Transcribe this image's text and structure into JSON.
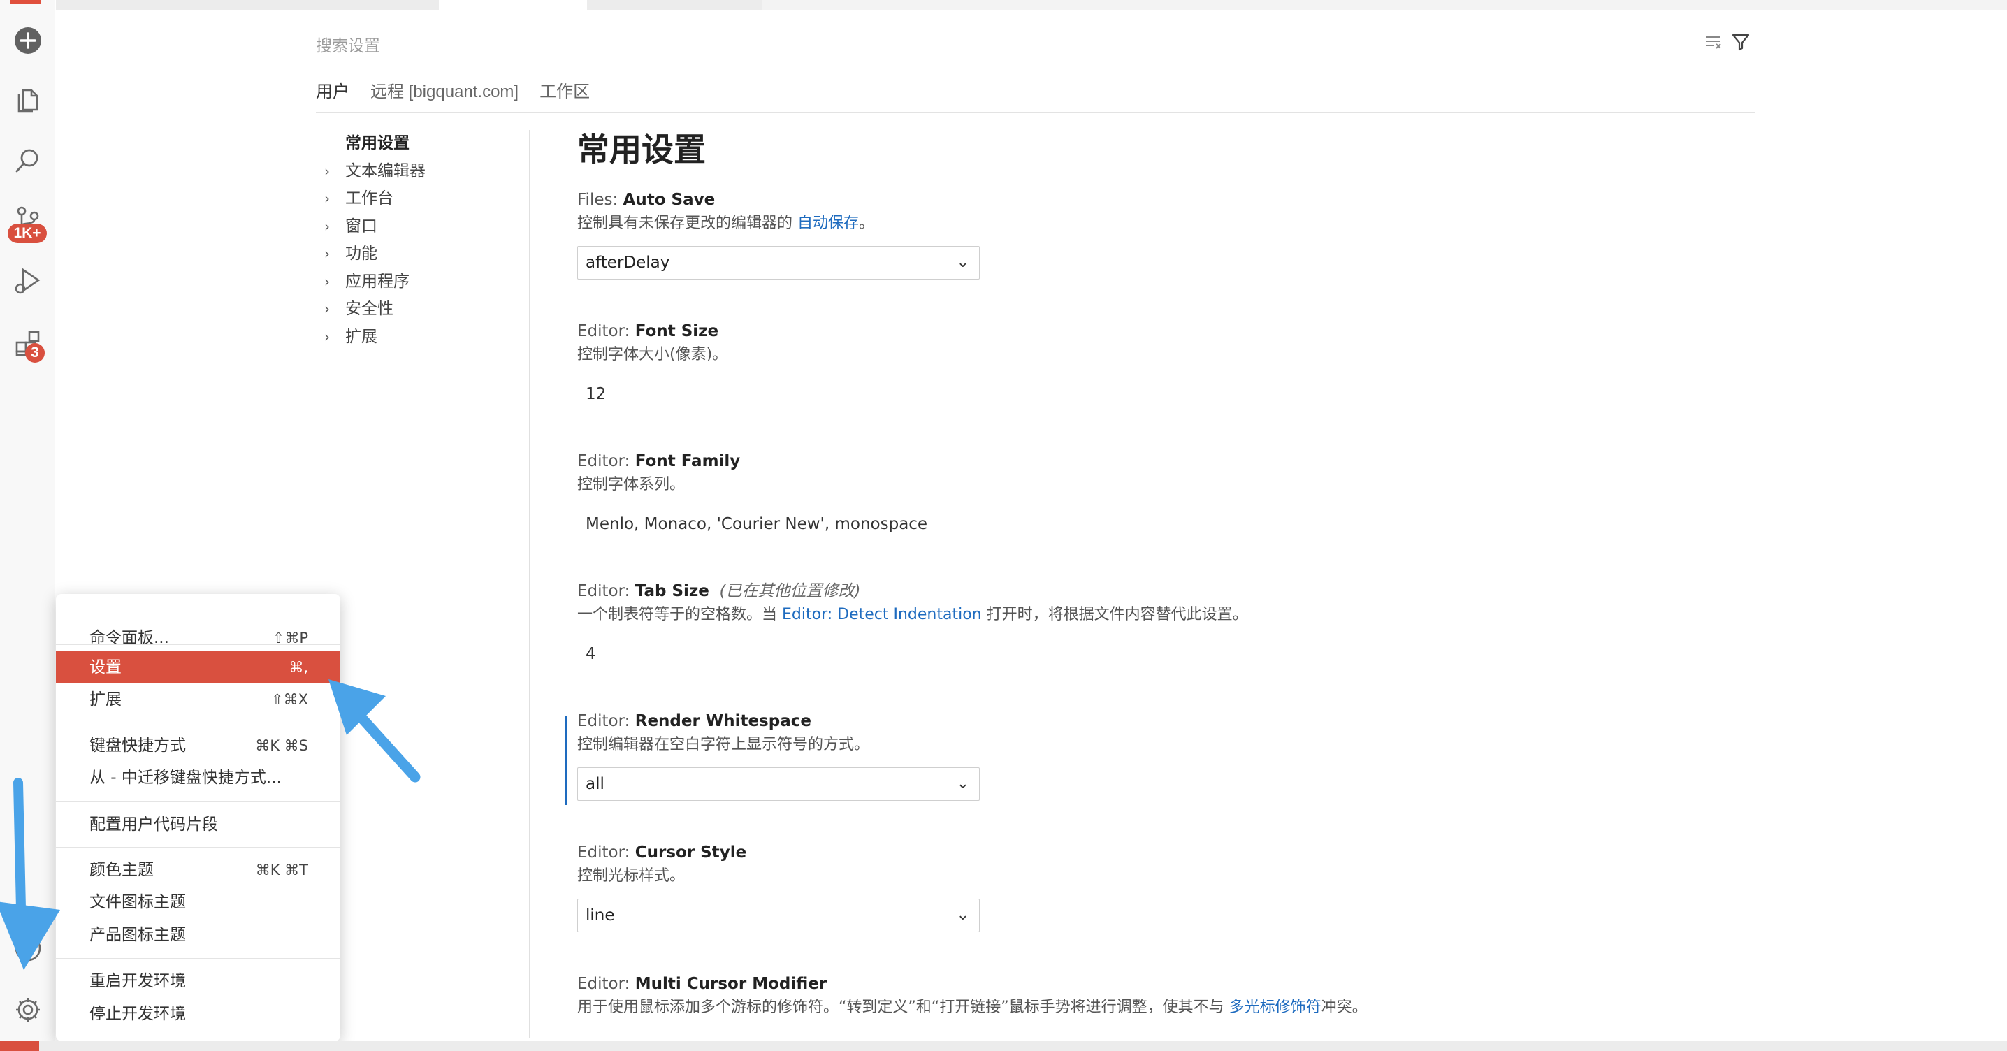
{
  "activity_bar": {
    "icons": [
      "add-icon",
      "explorer-icon",
      "search-icon",
      "source-control-icon",
      "run-debug-icon",
      "extensions-icon",
      "accounts-icon",
      "manage-gear-icon"
    ],
    "source_control_badge": "1K+",
    "extensions_badge": "3"
  },
  "settings": {
    "search_placeholder": "搜索设置",
    "scope_tabs": [
      "用户",
      "远程 [bigquant.com]",
      "工作区"
    ],
    "toc": {
      "root": "常用设置",
      "items": [
        "文本编辑器",
        "工作台",
        "窗口",
        "功能",
        "应用程序",
        "安全性",
        "扩展"
      ]
    },
    "section_title": "常用设置",
    "items": [
      {
        "category": "Files: ",
        "name": "Auto Save",
        "desc_pre": "控制具有未保存更改的编辑器的 ",
        "desc_link": "自动保存",
        "desc_post": "。",
        "value": "afterDelay"
      },
      {
        "category": "Editor: ",
        "name": "Font Size",
        "desc": "控制字体大小(像素)。",
        "value": "12"
      },
      {
        "category": "Editor: ",
        "name": "Font Family",
        "desc": "控制字体系列。",
        "value": "Menlo, Monaco, 'Courier New', monospace"
      },
      {
        "category": "Editor: ",
        "name": "Tab Size",
        "note": "(已在其他位置修改)",
        "desc_pre": "一个制表符等于的空格数。当 ",
        "desc_link": "Editor: Detect Indentation",
        "desc_post": " 打开时，将根据文件内容替代此设置。",
        "value": "4"
      },
      {
        "category": "Editor: ",
        "name": "Render Whitespace",
        "desc": "控制编辑器在空白字符上显示符号的方式。",
        "value": "all"
      },
      {
        "category": "Editor: ",
        "name": "Cursor Style",
        "desc": "控制光标样式。",
        "value": "line"
      },
      {
        "category": "Editor: ",
        "name": "Multi Cursor Modifier",
        "desc_pre": "用于使用鼠标添加多个游标的修饰符。“转到定义”和“打开链接”鼠标手势将进行调整，使其不与 ",
        "desc_link": "多光标修饰符",
        "desc_post": "冲突。"
      }
    ]
  },
  "manage_menu": {
    "items": [
      {
        "label": "命令面板...",
        "shortcut": "⇧⌘P"
      },
      {
        "label": "设置",
        "shortcut": "⌘,",
        "selected": true
      },
      {
        "label": "扩展",
        "shortcut": "⇧⌘X"
      },
      {
        "label": "键盘快捷方式",
        "shortcut": "⌘K ⌘S"
      },
      {
        "label": "从 - 中迁移键盘快捷方式...",
        "shortcut": ""
      },
      {
        "label": "配置用户代码片段",
        "shortcut": ""
      },
      {
        "label": "颜色主题",
        "shortcut": "⌘K ⌘T"
      },
      {
        "label": "文件图标主题",
        "shortcut": ""
      },
      {
        "label": "产品图标主题",
        "shortcut": ""
      },
      {
        "label": "重启开发环境",
        "shortcut": ""
      },
      {
        "label": "停止开发环境",
        "shortcut": ""
      }
    ]
  },
  "colors": {
    "accent": "#d9503f",
    "link": "#1e6bbf",
    "annotation_arrow": "#4aa3e8"
  }
}
